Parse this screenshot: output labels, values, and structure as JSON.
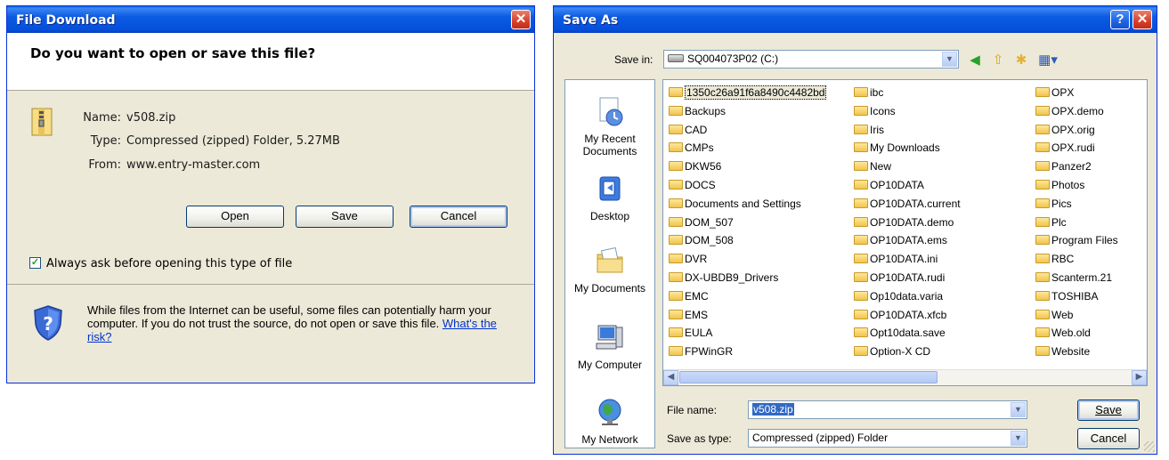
{
  "download": {
    "title": "File Download",
    "question": "Do you want to open or save this file?",
    "name_label": "Name:",
    "name_value": "v508.zip",
    "type_label": "Type:",
    "type_value": "Compressed (zipped) Folder, 5.27MB",
    "from_label": "From:",
    "from_value": "www.entry-master.com",
    "open_label": "Open",
    "save_label": "Save",
    "cancel_label": "Cancel",
    "checkbox_label": "Always ask before opening this type of file",
    "checkbox_checked": true,
    "warning_text": "While files from the Internet can be useful, some files can potentially harm your computer. If you do not trust the source, do not open or save this file.",
    "risk_link": "What's the risk?"
  },
  "saveas": {
    "title": "Save As",
    "save_in_label": "Save in:",
    "save_in_value": "SQ004073P02 (C:)",
    "places": [
      "My Recent Documents",
      "Desktop",
      "My Documents",
      "My Computer",
      "My Network"
    ],
    "folders_col1": [
      "1350c26a91f6a8490c4482bd",
      "Backups",
      "CAD",
      "CMPs",
      "DKW56",
      "DOCS",
      "Documents and Settings",
      "DOM_507",
      "DOM_508",
      "DVR",
      "DX-UBDB9_Drivers",
      "EMC",
      "EMS",
      "EULA",
      "FPWinGR"
    ],
    "folders_col2": [
      "ibc",
      "Icons",
      "Iris",
      "My Downloads",
      "New",
      "OP10DATA",
      "OP10DATA.current",
      "OP10DATA.demo",
      "OP10DATA.ems",
      "OP10DATA.ini",
      "OP10DATA.rudi",
      "Op10data.varia",
      "OP10DATA.xfcb",
      "Opt10data.save",
      "Option-X CD"
    ],
    "folders_col3": [
      "OPX",
      "OPX.demo",
      "OPX.orig",
      "OPX.rudi",
      "Panzer2",
      "Photos",
      "Pics",
      "Plc",
      "Program Files",
      "RBC",
      "Scanterm.21",
      "TOSHIBA",
      "Web",
      "Web.old",
      "Website"
    ],
    "file_name_label": "File name:",
    "file_name_value": "v508.zip",
    "save_type_label": "Save as type:",
    "save_type_value": "Compressed (zipped) Folder",
    "save_label": "Save",
    "cancel_label": "Cancel"
  },
  "colors": {
    "title_blue": "#0350dc",
    "face": "#ece9d8",
    "close_red": "#d6402a"
  }
}
